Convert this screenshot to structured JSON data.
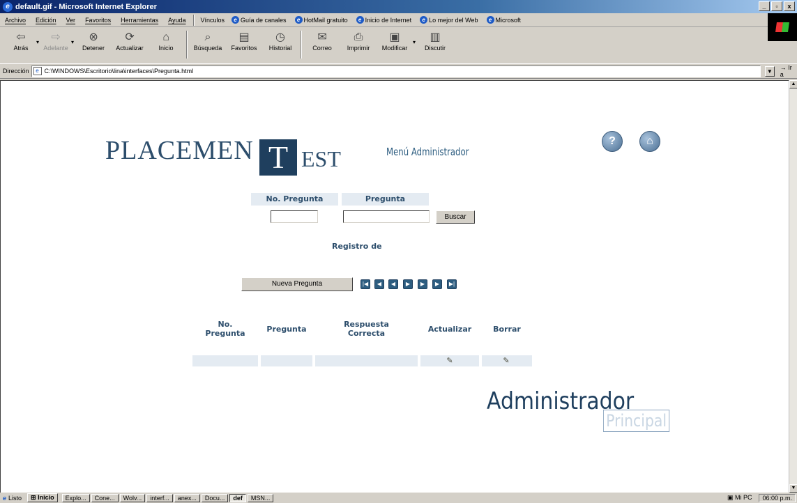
{
  "window": {
    "title": "default.gif - Microsoft Internet Explorer",
    "controls": [
      "_",
      "▫",
      "x"
    ]
  },
  "menu": {
    "items": [
      "Archivo",
      "Edición",
      "Ver",
      "Favoritos",
      "Herramientas",
      "Ayuda"
    ],
    "links_label": "Vínculos",
    "links": [
      "Guía de canales",
      "HotMail gratuito",
      "Inicio de Internet",
      "Lo mejor del Web",
      "Microsoft"
    ]
  },
  "toolbar": {
    "buttons": [
      {
        "label": "Atrás",
        "icon": "back-arrow-icon",
        "enabled": true
      },
      {
        "label": "Adelante",
        "icon": "forward-arrow-icon",
        "enabled": false
      },
      {
        "label": "Detener",
        "icon": "stop-icon",
        "enabled": true
      },
      {
        "label": "Actualizar",
        "icon": "refresh-icon",
        "enabled": true
      },
      {
        "label": "Inicio",
        "icon": "home-icon",
        "enabled": true
      },
      {
        "label": "Búsqueda",
        "icon": "search-icon",
        "enabled": true
      },
      {
        "label": "Favoritos",
        "icon": "favorites-icon",
        "enabled": true
      },
      {
        "label": "Historial",
        "icon": "history-icon",
        "enabled": true
      },
      {
        "label": "Correo",
        "icon": "mail-icon",
        "enabled": true
      },
      {
        "label": "Imprimir",
        "icon": "print-icon",
        "enabled": true
      },
      {
        "label": "Modificar",
        "icon": "edit-icon",
        "enabled": true
      },
      {
        "label": "Discutir",
        "icon": "discuss-icon",
        "enabled": true
      }
    ]
  },
  "address": {
    "label": "Dirección",
    "value": "C:\\WINDOWS\\Escritorio\\lina\\interfaces\\Pregunta.html",
    "go_label": "Ir a"
  },
  "page": {
    "logo_part1": "PLACEMEN",
    "logo_part2": "T",
    "logo_part3": "EST",
    "menu_title": "Menú Administrador",
    "help_icon_glyph": "?",
    "search": {
      "col1_header": "No. Pregunta",
      "col2_header": "Pregunta",
      "col1_value": "",
      "col2_value": "",
      "button_label": "Buscar"
    },
    "registro_label": "Registro de",
    "new_button_label": "Nueva Pregunta",
    "nav_buttons": [
      "first",
      "prev-page",
      "prev",
      "play",
      "next",
      "next-page",
      "last"
    ],
    "table": {
      "headers": [
        "No. Pregunta",
        "Pregunta",
        "Respuesta Correcta",
        "Actualizar",
        "Borrar"
      ],
      "header_lines": [
        [
          "No.",
          "Pregunta"
        ],
        [
          "Pregunta"
        ],
        [
          "Respuesta",
          "Correcta"
        ],
        [
          "Actualizar"
        ],
        [
          "Borrar"
        ]
      ]
    },
    "footer_big": "Administrador",
    "footer_small": "Principal"
  },
  "status": {
    "left_text": "Listo",
    "zone_text": "Mi PC"
  },
  "taskbar": {
    "start_label": "Inicio",
    "tasks": [
      "Explo...",
      "Cone...",
      "Wolv...",
      "interf...",
      "anex...",
      "Docu...",
      "def",
      "MSN..."
    ],
    "clock": "06:00 p.m."
  },
  "colors": {
    "brand_navy": "#1f3f5e",
    "brand_blue": "#2d5d80",
    "header_fill": "#e4ebf2"
  }
}
